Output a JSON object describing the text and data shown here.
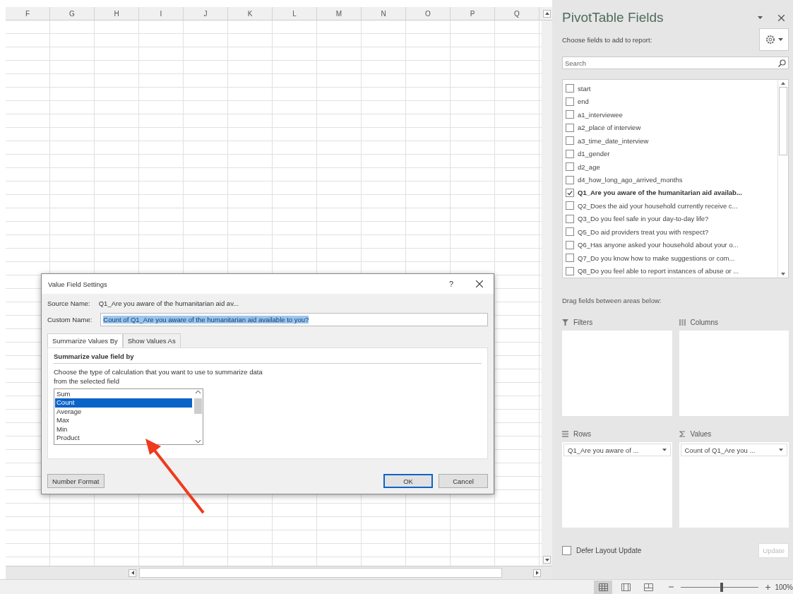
{
  "sheet": {
    "columns": [
      "F",
      "G",
      "H",
      "I",
      "J",
      "K",
      "L",
      "M",
      "N",
      "O",
      "P",
      "Q"
    ]
  },
  "dialog": {
    "title": "Value Field Settings",
    "help": "?",
    "source_label": "Source Name:",
    "source_value": "Q1_Are you aware of the humanitarian aid av...",
    "custom_label": "Custom Name:",
    "custom_value": "Count of Q1_Are you aware of the humanitarian aid available to you?",
    "tabs": [
      {
        "label": "Summarize Values By",
        "selected": true
      },
      {
        "label": "Show Values As",
        "selected": false
      }
    ],
    "section_title": "Summarize value field by",
    "description": "Choose the type of calculation that you want to use to summarize data from the selected field",
    "functions": [
      {
        "label": "Sum",
        "selected": false
      },
      {
        "label": "Count",
        "selected": true
      },
      {
        "label": "Average",
        "selected": false
      },
      {
        "label": "Max",
        "selected": false
      },
      {
        "label": "Min",
        "selected": false
      },
      {
        "label": "Product",
        "selected": false
      }
    ],
    "number_format_button": "Number Format",
    "ok_button": "OK",
    "cancel_button": "Cancel"
  },
  "pivot_pane": {
    "title": "PivotTable Fields",
    "choose_label": "Choose fields to add to report:",
    "search": {
      "placeholder": "Search"
    },
    "fields": [
      {
        "label": "start",
        "checked": false
      },
      {
        "label": "end",
        "checked": false
      },
      {
        "label": "a1_interviewee",
        "checked": false
      },
      {
        "label": "a2_place of interview",
        "checked": false
      },
      {
        "label": "a3_time_date_interview",
        "checked": false
      },
      {
        "label": "d1_gender",
        "checked": false
      },
      {
        "label": "d2_age",
        "checked": false
      },
      {
        "label": "d4_how_long_ago_arrived_months",
        "checked": false
      },
      {
        "label": "Q1_Are you aware of the humanitarian aid availab...",
        "checked": true
      },
      {
        "label": "Q2_Does the aid your household currently receive c...",
        "checked": false
      },
      {
        "label": "Q3_Do you feel safe in your day-to-day life?",
        "checked": false
      },
      {
        "label": "Q5_Do aid providers treat you with respect?",
        "checked": false
      },
      {
        "label": "Q6_Has anyone asked your household about your o...",
        "checked": false
      },
      {
        "label": "Q7_Do you know how to make suggestions or com...",
        "checked": false
      },
      {
        "label": "Q8_Do you feel able to report instances of abuse or ...",
        "checked": false
      }
    ],
    "drag_label": "Drag fields between areas below:",
    "areas": [
      {
        "kind": "filters",
        "label": "Filters"
      },
      {
        "kind": "columns",
        "label": "Columns"
      },
      {
        "kind": "rows",
        "label": "Rows",
        "items": [
          "Q1_Are you aware of ..."
        ]
      },
      {
        "kind": "values",
        "label": "Values",
        "items": [
          "Count of Q1_Are you ..."
        ]
      }
    ],
    "defer": {
      "label": "Defer Layout Update",
      "checked": false
    },
    "update_button": {
      "label": "Update",
      "disabled": true
    }
  },
  "status_bar": {
    "views": [
      {
        "kind": "normal",
        "selected": true
      },
      {
        "kind": "page-layout",
        "selected": false
      },
      {
        "kind": "page-break",
        "selected": false
      }
    ],
    "zoom": {
      "level": 0.52,
      "label": "100%"
    }
  }
}
